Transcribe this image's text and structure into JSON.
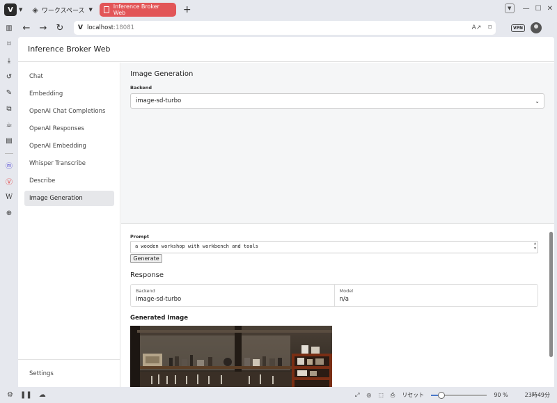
{
  "browser": {
    "workspace_label": "ワークスペース",
    "tab_title": "Inference Broker Web",
    "url_host": "localhost",
    "url_port": ":18081",
    "vpn_label": "VPN"
  },
  "app": {
    "title": "Inference Broker Web"
  },
  "sidebar": {
    "items": [
      {
        "label": "Chat"
      },
      {
        "label": "Embedding"
      },
      {
        "label": "OpenAI Chat Completions"
      },
      {
        "label": "OpenAI Responses"
      },
      {
        "label": "OpenAI Embedding"
      },
      {
        "label": "Whisper Transcribe"
      },
      {
        "label": "Describe"
      },
      {
        "label": "Image Generation"
      }
    ],
    "active_index": 7,
    "settings_label": "Settings"
  },
  "main": {
    "section_title": "Image Generation",
    "backend_label": "Backend",
    "backend_value": "image-sd-turbo",
    "prompt_label": "Prompt",
    "prompt_value": "a wooden workshop with workbench and tools",
    "generate_label": "Generate",
    "response_title": "Response",
    "response": {
      "backend_key": "Backend",
      "backend_value": "image-sd-turbo",
      "model_key": "Model",
      "model_value": "n/a"
    },
    "generated_title": "Generated Image"
  },
  "statusbar": {
    "reset_label": "リセット",
    "zoom": "90 %",
    "zoom_fraction": 0.18,
    "clock": "23時49分"
  },
  "colors": {
    "tab_active": "#e25557",
    "sidebar_active": "#e6e7ea"
  }
}
